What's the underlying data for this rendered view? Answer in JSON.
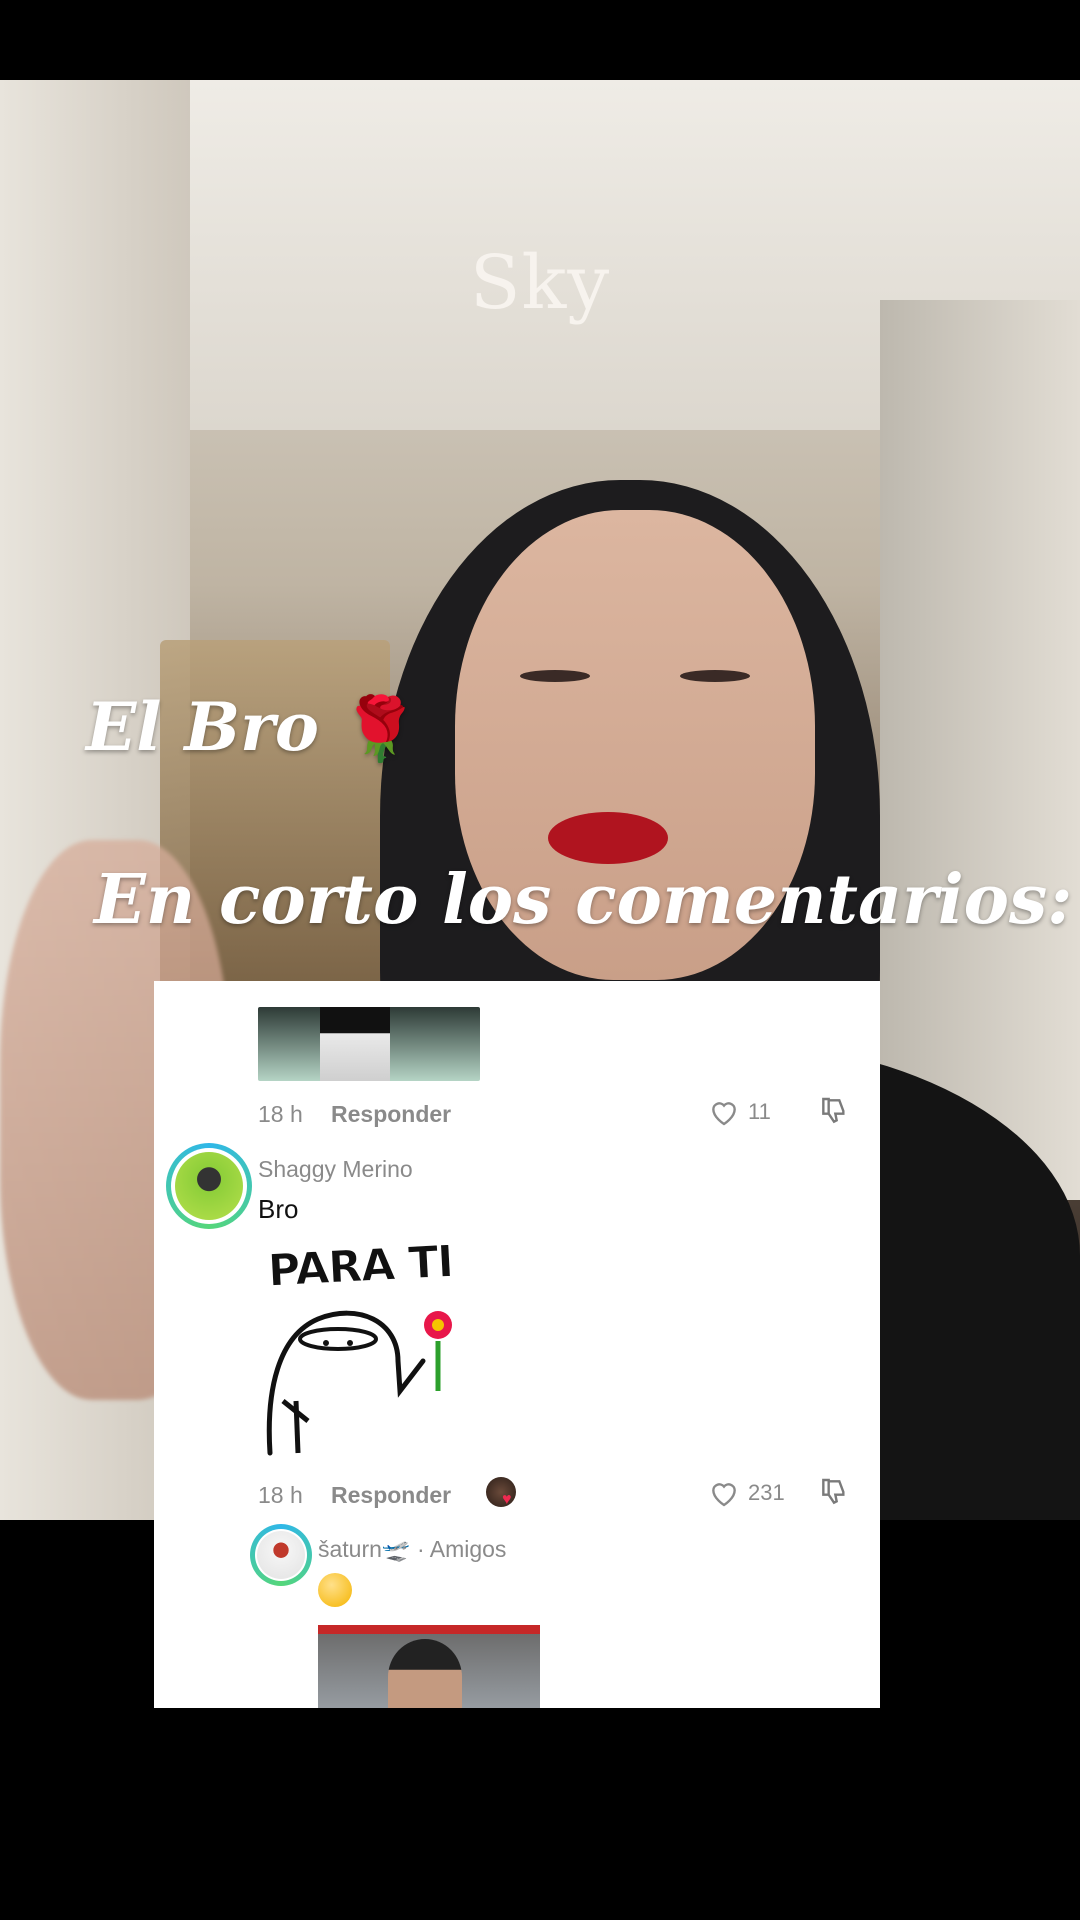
{
  "overlay": {
    "watermark": "Sky",
    "caption_line1": "El Bro",
    "caption_rose": "🌹",
    "caption_line2": "En corto los comentarios:"
  },
  "comments": {
    "first": {
      "time": "18 h",
      "reply_label": "Responder",
      "likes": "11"
    },
    "second": {
      "username": "Shaggy Merino",
      "text": "Bro",
      "sticker_text": "PARA TI",
      "time": "18 h",
      "reply_label": "Responder",
      "likes": "231"
    },
    "reply": {
      "username": "šaturn🛫",
      "tag": " · Amigos",
      "emoji": "🤭"
    }
  },
  "icons": {
    "like": "heart-outline-icon",
    "dislike": "thumbs-down-icon",
    "creator_liked": "creator-liked-avatar-icon"
  }
}
